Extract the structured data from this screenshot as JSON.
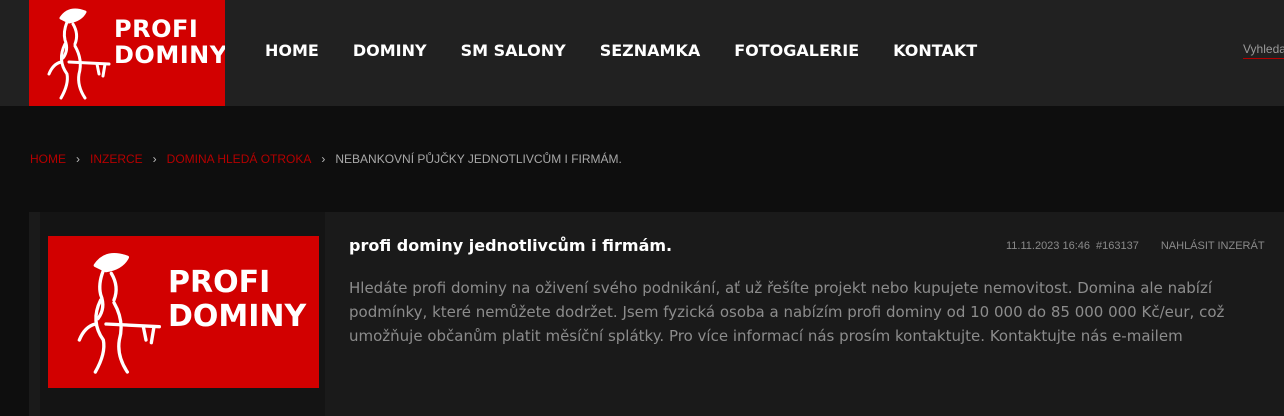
{
  "header": {
    "logo": {
      "line1": "PROFI",
      "line2": "DOMINY"
    },
    "nav": [
      "HOME",
      "DOMINY",
      "SM SALONY",
      "SEZNAMKA",
      "FOTOGALERIE",
      "KONTAKT"
    ],
    "search_placeholder": "Vyhledat"
  },
  "breadcrumb": {
    "items": [
      "HOME",
      "INZERCE",
      "DOMINA HLEDÁ OTROKA"
    ],
    "current": "NEBANKOVNÍ PŮJČKY JEDNOTLIVCŮM I FIRMÁM."
  },
  "ad": {
    "thumb": {
      "line1": "PROFI",
      "line2": "DOMINY"
    },
    "title": "profi dominy jednotlivcům i firmám.",
    "date": "11.11.2023 16:46",
    "id": "#163137",
    "report": "NAHLÁSIT INZERÁT",
    "body": "Hledáte profi dominy na oživení svého podnikání, ať už řešíte projekt nebo kupujete nemovitost. Domina ale nabízí podmínky, které nemůžete dodržet. Jsem fyzická osoba a nabízím profi dominy od 10 000 do 85 000 000 Kč/eur, což umožňuje občanům platit měsíční splátky. Pro více informací nás prosím kontaktujte. Kontaktujte nás e-mailem"
  },
  "colors": {
    "brand_red": "#d20000",
    "header_bg": "#212121",
    "page_bg": "#0e0e0e"
  }
}
